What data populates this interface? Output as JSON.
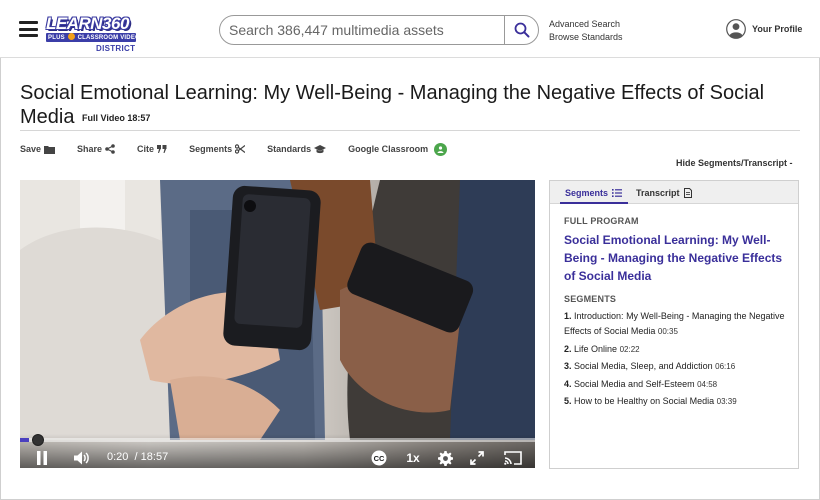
{
  "header": {
    "logo_main": "LEARN360",
    "logo_plus": "PLUS",
    "logo_classroom": "CLASSROOM VIDEO",
    "logo_district": "DISTRICT",
    "search_placeholder": "Search 386,447 multimedia assets",
    "advanced_search": "Advanced Search",
    "browse_standards": "Browse Standards",
    "profile_label": "Your Profile"
  },
  "page": {
    "title": "Social Emotional Learning: My Well-Being - Managing the Negative Effects of Social Media",
    "badge": "Full Video 18:57"
  },
  "toolbar": {
    "save": "Save",
    "share": "Share",
    "cite": "Cite",
    "segments": "Segments",
    "standards": "Standards",
    "google_classroom": "Google Classroom",
    "hide_link": "Hide Segments/Transcript -"
  },
  "player": {
    "current_time": "0:20",
    "duration": "/ 18:57",
    "progress_fraction": 0.0176,
    "speed": "1x",
    "accent_color": "#4a3fbf"
  },
  "panel": {
    "tab_segments": "Segments",
    "tab_transcript": "Transcript",
    "full_program_label": "FULL PROGRAM",
    "program_title": "Social Emotional Learning: My Well-Being - Managing the Negative Effects of Social Media",
    "segments_label": "SEGMENTS",
    "segments": [
      {
        "num": "1.",
        "title": "Introduction: My Well-Being - Managing the Negative Effects of Social Media",
        "duration": "00:35"
      },
      {
        "num": "2.",
        "title": "Life Online",
        "duration": "02:22"
      },
      {
        "num": "3.",
        "title": "Social Media, Sleep, and Addiction",
        "duration": "06:16"
      },
      {
        "num": "4.",
        "title": "Social Media and Self-Esteem",
        "duration": "04:58"
      },
      {
        "num": "5.",
        "title": "How to be Healthy on Social Media",
        "duration": "03:39"
      }
    ]
  }
}
